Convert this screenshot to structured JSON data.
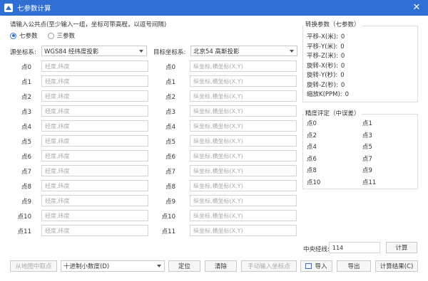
{
  "window": {
    "title": "七参数计算",
    "close": "✕"
  },
  "prompt": "请输入公共点(至少输入一组，坐标可带高程，以逗号间隔)",
  "mode": {
    "options": [
      "七参数",
      "三参数"
    ],
    "selected": "七参数"
  },
  "source": {
    "label": "源坐标系:",
    "value": "WGS84 经纬度投影"
  },
  "target": {
    "label": "目标坐标系:",
    "value": "北京54 高斯投影"
  },
  "points": {
    "labels": [
      "点0",
      "点1",
      "点2",
      "点3",
      "点4",
      "点5",
      "点6",
      "点7",
      "点8",
      "点9",
      "点10",
      "点11"
    ],
    "source_placeholder": "经度,纬度",
    "target_placeholder": "纵坐标,横坐标(X,Y)"
  },
  "params": {
    "title": "转换参数（七参数）",
    "items": [
      {
        "label": "平移-X(米):",
        "value": "0"
      },
      {
        "label": "平移-Y(米):",
        "value": "0"
      },
      {
        "label": "平移-Z(米):",
        "value": "0"
      },
      {
        "label": "旋转-X(秒):",
        "value": "0"
      },
      {
        "label": "旋转-Y(秒):",
        "value": "0"
      },
      {
        "label": "旋转-Z(秒):",
        "value": "0"
      },
      {
        "label": "缩放K(PPM):",
        "value": "0"
      }
    ]
  },
  "accuracy": {
    "title": "精度评定（中误差）",
    "items": [
      "点0",
      "点1",
      "点2",
      "点3",
      "点4",
      "点5",
      "点6",
      "点7",
      "点8",
      "点9",
      "点10",
      "点11"
    ]
  },
  "meridian": {
    "label": "中央经线:",
    "value": "114",
    "button": "计算"
  },
  "footer": {
    "pick_map": "从地图中取点",
    "format": "十进制小数度(D)",
    "locate": "定位",
    "clear": "清除",
    "manual": "手动输入坐标点",
    "import": "导入",
    "export": "导出",
    "save": "计算结果(C)"
  },
  "colors": {
    "accent": "#2f6fd4"
  },
  "icons": {
    "app": "app-icon",
    "close": "close-icon",
    "import": "import-icon"
  }
}
